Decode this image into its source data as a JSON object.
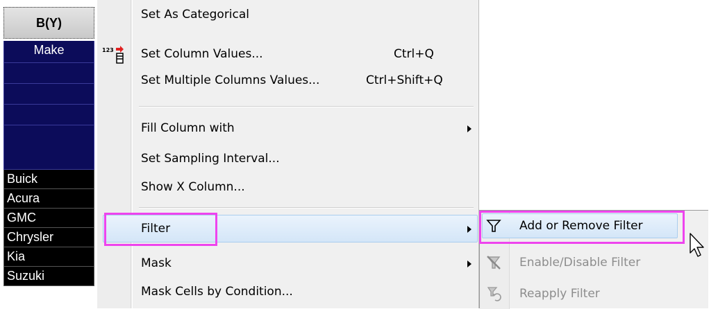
{
  "worksheet": {
    "column_header": "B(Y)",
    "long_name": "Make",
    "values": [
      "Buick",
      "Acura",
      "GMC",
      "Chrysler",
      "Kia",
      "Suzuki"
    ]
  },
  "context_menu": {
    "items": [
      {
        "label": "Set As Categorical",
        "shortcut": ""
      },
      {
        "label": "Set Column Values...",
        "shortcut": "Ctrl+Q",
        "icon": "set-column-values-icon"
      },
      {
        "label": "Set Multiple Columns Values...",
        "shortcut": "Ctrl+Shift+Q"
      },
      {
        "label": "Fill Column with",
        "submenu": true
      },
      {
        "label": "Set Sampling Interval..."
      },
      {
        "label": "Show X Column..."
      },
      {
        "label": "Filter",
        "submenu": true,
        "active": true
      },
      {
        "label": "Mask",
        "submenu": true
      },
      {
        "label": "Mask Cells by Condition..."
      }
    ]
  },
  "filter_submenu": {
    "items": [
      {
        "label": "Add or Remove Filter",
        "icon": "filter-icon",
        "enabled": true,
        "active": true
      },
      {
        "label": "Enable/Disable Filter",
        "icon": "disable-filter-icon",
        "enabled": false
      },
      {
        "label": "Reapply Filter",
        "icon": "reapply-filter-icon",
        "enabled": false
      }
    ]
  },
  "colors": {
    "highlight_outline": "#ee44ee",
    "cell_header_bg": "#0c0c5a",
    "cell_data_bg": "#000000",
    "menu_bg": "#f0f0f0"
  }
}
